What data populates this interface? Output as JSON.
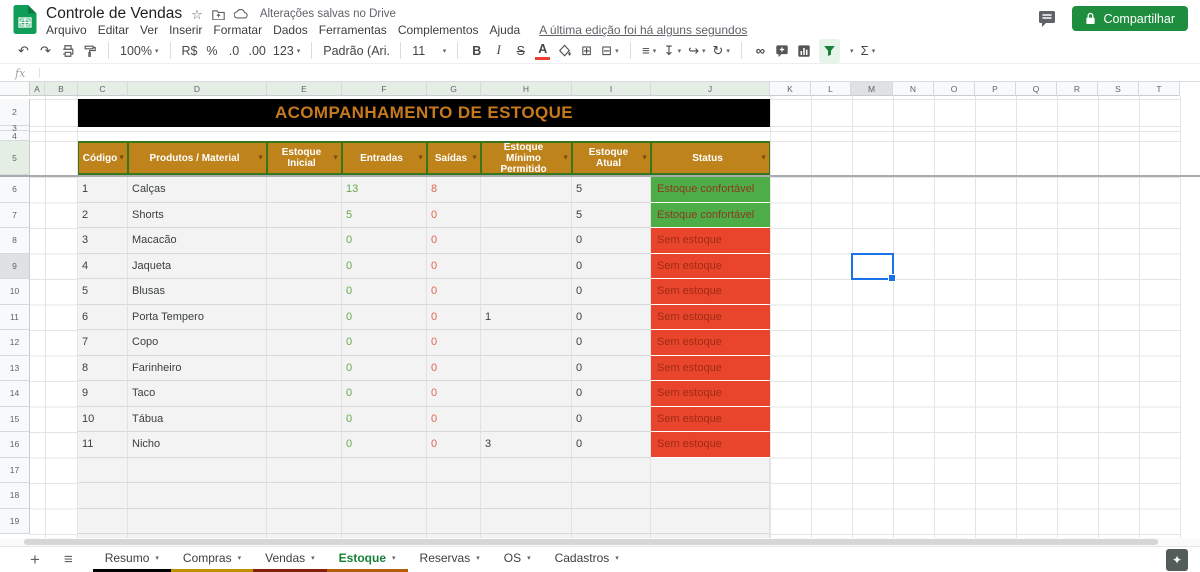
{
  "topbar": {
    "title": "Controle de Vendas",
    "star_icon": "☆",
    "saved_status": "Alterações salvas no Drive",
    "menus": [
      "Arquivo",
      "Editar",
      "Ver",
      "Inserir",
      "Formatar",
      "Dados",
      "Ferramentas",
      "Complementos",
      "Ajuda"
    ],
    "last_edit_link": "A última edição foi há alguns segundos",
    "share_label": "Compartilhar"
  },
  "toolbar": {
    "zoom": "100%",
    "currency": "R$",
    "percent": "%",
    "decimal_decrease": ".0",
    "decimal_increase": ".00",
    "more_formats": "123",
    "font_name": "Padrão (Ari...",
    "font_size": "11",
    "bold": "B",
    "italic": "I",
    "strikethrough": "S",
    "text_color": "A",
    "functions": "Σ",
    "icons": {
      "undo": "↶",
      "redo": "↷",
      "borders": "⊞",
      "merge_cells": "⊟",
      "horizontal_align": "≡",
      "vertical_align": "↧",
      "text_wrap": "↪",
      "text_rotation": "↻",
      "insert_link": "∞",
      "caret": "▾"
    }
  },
  "formula_bar": {
    "fx": "fx"
  },
  "grid": {
    "col_letters": [
      "A",
      "B",
      "C",
      "D",
      "E",
      "F",
      "G",
      "H",
      "I",
      "J",
      "K",
      "L",
      "M",
      "N",
      "O",
      "P",
      "Q",
      "R",
      "S",
      "T"
    ],
    "row_numbers": [
      "2",
      "3",
      "4",
      "5",
      "6",
      "7",
      "8",
      "9",
      "10",
      "11",
      "12",
      "13",
      "14",
      "15",
      "16",
      "17",
      "18",
      "19"
    ]
  },
  "table": {
    "banner": "ACOMPANHAMENTO DE ESTOQUE",
    "filter_icon": "▼",
    "columns": [
      "Código",
      "Produtos / Material",
      "Estoque Inicial",
      "Entradas",
      "Saídas",
      "Estoque Mínimo Permitido",
      "Estoque Atual",
      "Status"
    ],
    "rows": [
      {
        "codigo": "1",
        "produto": "Calças",
        "estoque_inicial": "",
        "entradas": "13",
        "saidas": "8",
        "estoque_minimo": "",
        "estoque_atual": "5",
        "status": "Estoque confortável",
        "status_type": "ok"
      },
      {
        "codigo": "2",
        "produto": "Shorts",
        "estoque_inicial": "",
        "entradas": "5",
        "saidas": "0",
        "estoque_minimo": "",
        "estoque_atual": "5",
        "status": "Estoque confortável",
        "status_type": "ok"
      },
      {
        "codigo": "3",
        "produto": "Macacão",
        "estoque_inicial": "",
        "entradas": "0",
        "saidas": "0",
        "estoque_minimo": "",
        "estoque_atual": "0",
        "status": "Sem estoque",
        "status_type": "bad"
      },
      {
        "codigo": "4",
        "produto": "Jaqueta",
        "estoque_inicial": "",
        "entradas": "0",
        "saidas": "0",
        "estoque_minimo": "",
        "estoque_atual": "0",
        "status": "Sem estoque",
        "status_type": "bad"
      },
      {
        "codigo": "5",
        "produto": "Blusas",
        "estoque_inicial": "",
        "entradas": "0",
        "saidas": "0",
        "estoque_minimo": "",
        "estoque_atual": "0",
        "status": "Sem estoque",
        "status_type": "bad"
      },
      {
        "codigo": "6",
        "produto": "Porta Tempero",
        "estoque_inicial": "",
        "entradas": "0",
        "saidas": "0",
        "estoque_minimo": "1",
        "estoque_atual": "0",
        "status": "Sem estoque",
        "status_type": "bad"
      },
      {
        "codigo": "7",
        "produto": "Copo",
        "estoque_inicial": "",
        "entradas": "0",
        "saidas": "0",
        "estoque_minimo": "",
        "estoque_atual": "0",
        "status": "Sem estoque",
        "status_type": "bad"
      },
      {
        "codigo": "8",
        "produto": "Farinheiro",
        "estoque_inicial": "",
        "entradas": "0",
        "saidas": "0",
        "estoque_minimo": "",
        "estoque_atual": "0",
        "status": "Sem estoque",
        "status_type": "bad"
      },
      {
        "codigo": "9",
        "produto": "Taco",
        "estoque_inicial": "",
        "entradas": "0",
        "saidas": "0",
        "estoque_minimo": "",
        "estoque_atual": "0",
        "status": "Sem estoque",
        "status_type": "bad"
      },
      {
        "codigo": "10",
        "produto": "Tábua",
        "estoque_inicial": "",
        "entradas": "0",
        "saidas": "0",
        "estoque_minimo": "",
        "estoque_atual": "0",
        "status": "Sem estoque",
        "status_type": "bad"
      },
      {
        "codigo": "11",
        "produto": "Nicho",
        "estoque_inicial": "",
        "entradas": "0",
        "saidas": "0",
        "estoque_minimo": "3",
        "estoque_atual": "0",
        "status": "Sem estoque",
        "status_type": "bad"
      }
    ]
  },
  "bottombar": {
    "add_sheet": "+",
    "all_sheets": "≡",
    "explore_icon": "✦",
    "tabs": [
      {
        "label": "Resumo",
        "color": "#000000",
        "active": false
      },
      {
        "label": "Compras",
        "color": "#bf9000",
        "active": false
      },
      {
        "label": "Vendas",
        "color": "#85200c",
        "active": false
      },
      {
        "label": "Estoque",
        "color": "#b45f06",
        "active": true
      },
      {
        "label": "Reservas",
        "color": "",
        "active": false
      },
      {
        "label": "OS",
        "color": "",
        "active": false
      },
      {
        "label": "Cadastros",
        "color": "",
        "active": false
      }
    ]
  },
  "colors": {
    "header_bg": "#bf831c",
    "header_border": "#38761d",
    "banner_bg": "#000000",
    "banner_text": "#c7791d",
    "status_ok_bg": "#4dad47",
    "status_ok_text": "#8a3b1e",
    "status_bad_bg": "#e8452c",
    "status_bad_text": "#a02c12",
    "entradas_text": "#6aa84f",
    "saidas_text": "#e06652",
    "selection": "#1a73e8",
    "share_button": "#1e8e3e",
    "active_tab_text": "#188038",
    "filter_active": "#188038"
  }
}
